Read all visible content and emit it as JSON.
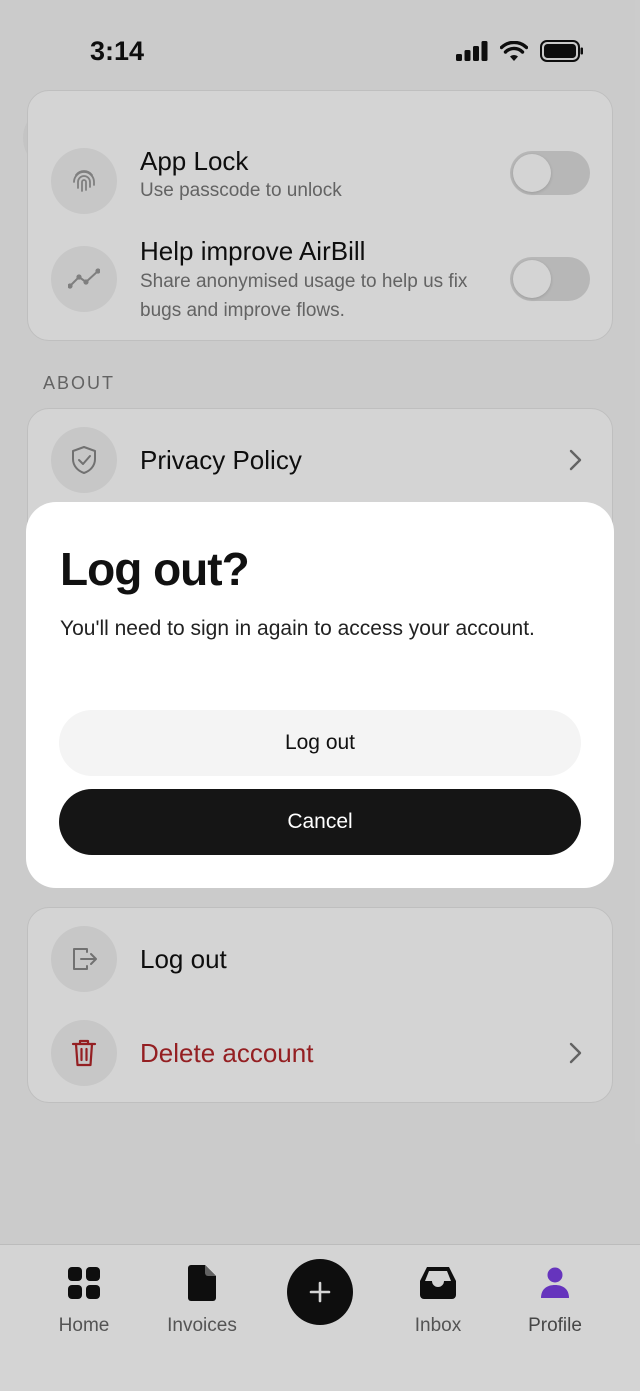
{
  "status_bar": {
    "time": "3:14"
  },
  "header": {
    "faded_text": ""
  },
  "privacy_section": {
    "rows": [
      {
        "title": "App Lock",
        "subtitle": "Use passcode to unlock",
        "toggle_on": false
      },
      {
        "title": "Help improve AirBill",
        "subtitle": "Share anonymised usage to help us fix bugs and improve flows.",
        "toggle_on": false
      }
    ]
  },
  "about_section": {
    "label": "ABOUT",
    "rows": [
      {
        "title": "Privacy Policy"
      }
    ]
  },
  "account_section": {
    "rows": [
      {
        "title": "Log out"
      },
      {
        "title": "Delete account"
      }
    ]
  },
  "colors": {
    "danger": "#b3262a",
    "accent": "#7b3fe4",
    "dark": "#151515"
  },
  "bottom_nav": {
    "items": [
      {
        "label": "Home",
        "icon": "home-grid-icon"
      },
      {
        "label": "Invoices",
        "icon": "document-icon"
      },
      {
        "label": "Inbox",
        "icon": "inbox-icon"
      },
      {
        "label": "Profile",
        "icon": "person-icon",
        "active": true
      }
    ],
    "fab_icon": "plus-icon"
  },
  "dialog": {
    "title": "Log out?",
    "message": "You'll need to sign in again to access your account.",
    "confirm_label": "Log out",
    "cancel_label": "Cancel"
  }
}
